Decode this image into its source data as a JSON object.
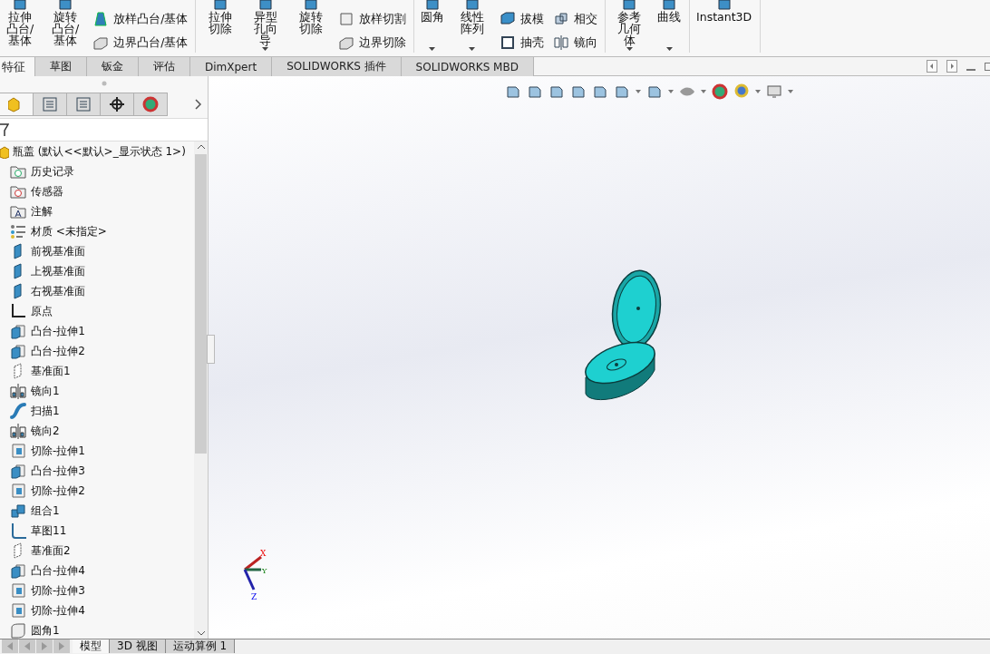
{
  "ribbon": {
    "groups": [
      {
        "items": [
          {
            "kind": "large",
            "label": "拉伸凸台/基体",
            "dropdown": false
          },
          {
            "kind": "large",
            "label": "旋转凸台/基体",
            "dropdown": false
          },
          {
            "kind": "stack",
            "items": [
              {
                "label": "放样凸台/基体"
              },
              {
                "label": "边界凸台/基体"
              }
            ]
          }
        ]
      },
      {
        "items": [
          {
            "kind": "large",
            "label": "拉伸切除",
            "dropdown": false
          },
          {
            "kind": "large",
            "label": "异型孔向导",
            "dropdown": true
          },
          {
            "kind": "large",
            "label": "旋转切除",
            "dropdown": false
          },
          {
            "kind": "stack",
            "items": [
              {
                "label": "放样切割"
              },
              {
                "label": "边界切除"
              }
            ]
          }
        ]
      },
      {
        "items": [
          {
            "kind": "large",
            "label": "圆角",
            "dropdown": true
          },
          {
            "kind": "large",
            "label": "线性阵列",
            "dropdown": true
          },
          {
            "kind": "stack",
            "items": [
              {
                "label": "拔模"
              },
              {
                "label": "抽壳"
              }
            ]
          },
          {
            "kind": "stack",
            "items": [
              {
                "label": "相交"
              },
              {
                "label": "镜向"
              }
            ]
          }
        ]
      },
      {
        "items": [
          {
            "kind": "large",
            "label": "参考几何体",
            "dropdown": true
          },
          {
            "kind": "large",
            "label": "曲线",
            "dropdown": true
          }
        ]
      },
      {
        "items": [
          {
            "kind": "large",
            "label": "Instant3D",
            "dropdown": false
          }
        ]
      }
    ]
  },
  "tabs": [
    {
      "label": "特征",
      "selected": true
    },
    {
      "label": "草图",
      "selected": false
    },
    {
      "label": "钣金",
      "selected": false
    },
    {
      "label": "评估",
      "selected": false
    },
    {
      "label": "DimXpert",
      "selected": false
    },
    {
      "label": "SOLIDWORKS 插件",
      "selected": false
    },
    {
      "label": "SOLIDWORKS MBD",
      "selected": false
    }
  ],
  "panel_tabs": [
    {
      "selected": true
    },
    {
      "selected": false
    },
    {
      "selected": false
    },
    {
      "selected": false
    },
    {
      "selected": false
    }
  ],
  "tree": {
    "label": "瓶盖 (默认<<默认>_显示状态 1>)",
    "children": [
      {
        "label": "历史记录",
        "kind": "history"
      },
      {
        "label": "传感器",
        "kind": "sensor"
      },
      {
        "label": "注解",
        "kind": "annotation"
      },
      {
        "label": "材质 <未指定>",
        "kind": "material"
      },
      {
        "label": "前视基准面",
        "kind": "plane"
      },
      {
        "label": "上视基准面",
        "kind": "plane"
      },
      {
        "label": "右视基准面",
        "kind": "plane"
      },
      {
        "label": "原点",
        "kind": "origin"
      },
      {
        "label": "凸台-拉伸1",
        "kind": "boss"
      },
      {
        "label": "凸台-拉伸2",
        "kind": "boss"
      },
      {
        "label": "基准面1",
        "kind": "refplane"
      },
      {
        "label": "镜向1",
        "kind": "mirror"
      },
      {
        "label": "扫描1",
        "kind": "sweep"
      },
      {
        "label": "镜向2",
        "kind": "mirror"
      },
      {
        "label": "切除-拉伸1",
        "kind": "cut"
      },
      {
        "label": "凸台-拉伸3",
        "kind": "boss"
      },
      {
        "label": "切除-拉伸2",
        "kind": "cut"
      },
      {
        "label": "组合1",
        "kind": "combine"
      },
      {
        "label": "草图11",
        "kind": "sketch"
      },
      {
        "label": "基准面2",
        "kind": "refplane"
      },
      {
        "label": "凸台-拉伸4",
        "kind": "boss"
      },
      {
        "label": "切除-拉伸3",
        "kind": "cut"
      },
      {
        "label": "切除-拉伸4",
        "kind": "cut"
      },
      {
        "label": "圆角1",
        "kind": "fillet"
      }
    ]
  },
  "triad": {
    "x": "X",
    "y": "Y",
    "z": "Z"
  },
  "bottom_tabs": [
    {
      "label": "模型",
      "selected": true
    },
    {
      "label": "3D 视图",
      "selected": false
    },
    {
      "label": "运动算例 1",
      "selected": false
    }
  ]
}
